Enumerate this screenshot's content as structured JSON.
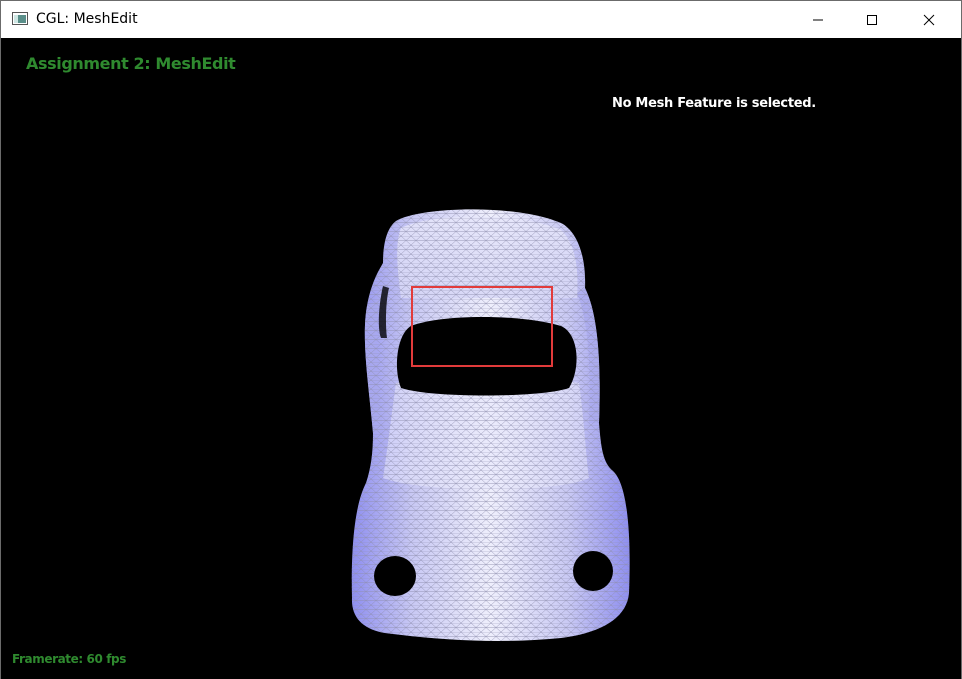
{
  "window": {
    "title": "CGL: MeshEdit",
    "icon": "app-window-icon",
    "controls": [
      "minimize-icon",
      "maximize-icon",
      "close-icon"
    ]
  },
  "viewport": {
    "assignment_title": "Assignment 2: MeshEdit",
    "selection_status": "No Mesh Feature is selected.",
    "framerate": "Framerate: 60 fps",
    "mesh_icon": "car-mesh-wireframe",
    "colors": {
      "background": "#000000",
      "label_green": "#2f8a2f",
      "mesh_fill": "#dcdcf6",
      "mesh_shade": "#8f8ff0",
      "wire": "#9a9ab8",
      "annotation": "#e23b3b"
    }
  }
}
